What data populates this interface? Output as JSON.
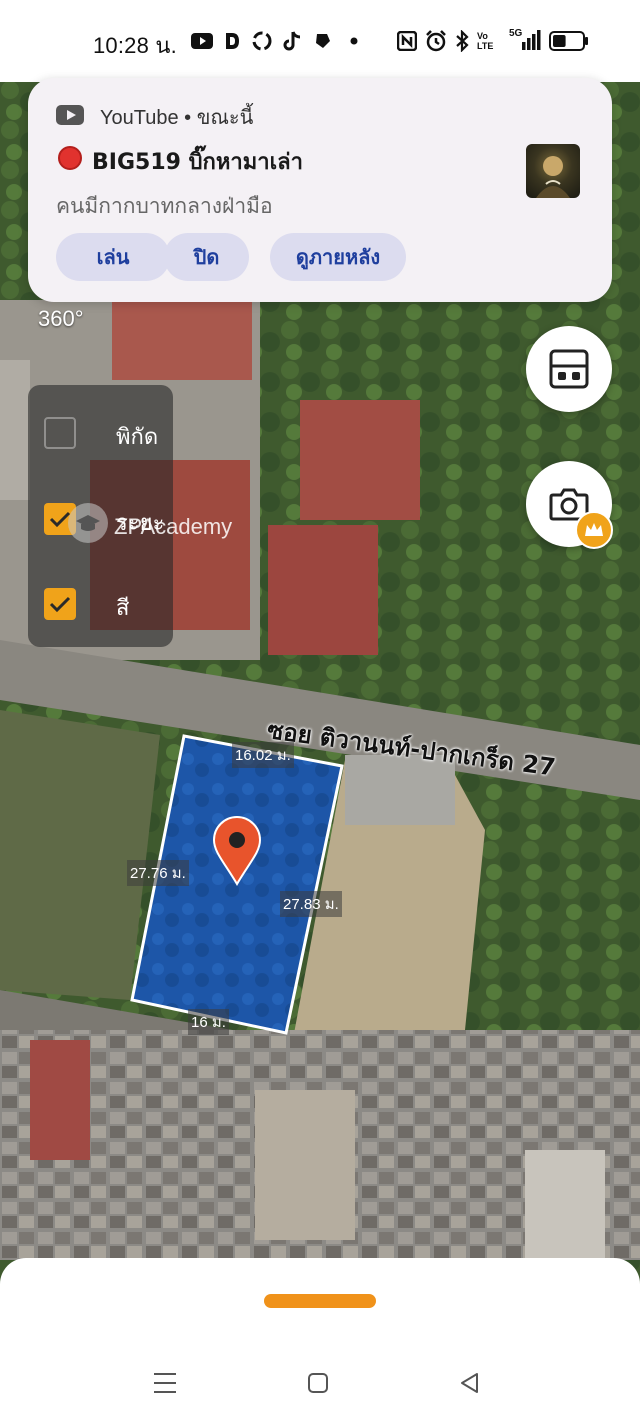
{
  "status_bar": {
    "time": "10:28 น.",
    "left_icons": [
      "youtube-icon",
      "d-app-icon",
      "recycle-icon",
      "tiktok-icon",
      "game-icon",
      "dot-icon"
    ],
    "right_icons": [
      "nfc-icon",
      "alarm-icon",
      "bluetooth-icon",
      "volte-icon",
      "5g-signal-icon",
      "battery-icon"
    ],
    "network_label": "5G",
    "volte_label": "Vo LTE",
    "battery_level": 0.45
  },
  "notification": {
    "app_name": "YouTube • ขณะนี้",
    "title": "BIG519 บิ๊กหามาเล่า",
    "body": "คนมีกากบาทกลางฝ่ามือ",
    "actions": [
      "เล่น",
      "ปิด",
      "ดูภายหลัง"
    ],
    "thumbnail_icon": "channel-avatar"
  },
  "map": {
    "compass_label": "360°",
    "layers": [
      {
        "label": "พิกัด",
        "checked": false
      },
      {
        "label": "ระยะ",
        "checked": true
      },
      {
        "label": "สี",
        "checked": true
      }
    ],
    "watermark": "ZPAcademy",
    "road_label": "ซอย ติวานนท์-ปากเกร็ด 27",
    "dimensions": {
      "top": "16.02 ม.",
      "left": "27.76 ม.",
      "right": "27.83 ม.",
      "bottom": "16 ม."
    },
    "plot_color": "#1e5db8",
    "accent_color": "#f0a31a"
  },
  "fabs": [
    {
      "icon": "calculator-icon"
    },
    {
      "icon": "camera-icon",
      "badge": "crown-icon"
    }
  ],
  "bottom_sheet": {
    "handle_color": "#f0921a"
  },
  "nav_bar": [
    "menu-icon",
    "home-square-icon",
    "back-triangle-icon"
  ]
}
